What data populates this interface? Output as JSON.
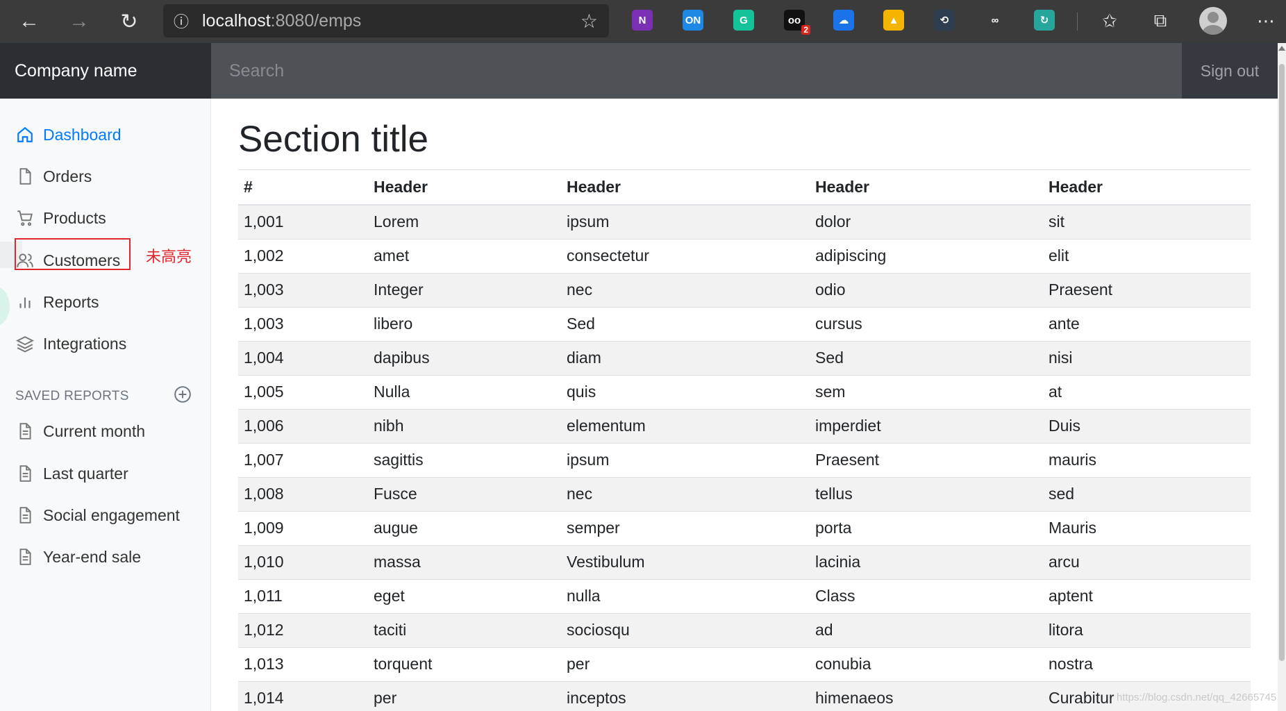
{
  "browser": {
    "url_host": "localhost",
    "url_path": ":8080/emps",
    "extensions": [
      {
        "name": "onenote-icon",
        "label": "N",
        "color": "#7b2fb5"
      },
      {
        "name": "onetab-icon",
        "label": "ON",
        "color": "#1e88e5"
      },
      {
        "name": "grammarly-icon",
        "label": "G",
        "color": "#15c39a"
      },
      {
        "name": "ext-badge-icon",
        "label": "oo",
        "color": "#111111",
        "badge": "2"
      },
      {
        "name": "cloud-icon",
        "label": "☁",
        "color": "#1a73e8"
      },
      {
        "name": "drive-icon",
        "label": "▲",
        "color": "#f4b400"
      },
      {
        "name": "link-icon",
        "label": "⟲",
        "color": "#2c3e50"
      },
      {
        "name": "chain-icon",
        "label": "∞",
        "color": "#3b3b3b"
      },
      {
        "name": "sync-icon",
        "label": "↻",
        "color": "#26a69a"
      }
    ]
  },
  "navbar": {
    "brand": "Company name",
    "search_placeholder": "Search",
    "signout": "Sign out"
  },
  "sidebar": {
    "items": [
      {
        "label": "Dashboard",
        "icon": "home-icon",
        "active": true
      },
      {
        "label": "Orders",
        "icon": "file-icon"
      },
      {
        "label": "Products",
        "icon": "cart-icon"
      },
      {
        "label": "Customers",
        "icon": "users-icon"
      },
      {
        "label": "Reports",
        "icon": "bar-chart-icon"
      },
      {
        "label": "Integrations",
        "icon": "layers-icon"
      }
    ],
    "annotation": "未高亮",
    "saved_heading": "SAVED REPORTS",
    "saved_items": [
      "Current month",
      "Last quarter",
      "Social engagement",
      "Year-end sale"
    ]
  },
  "main": {
    "title": "Section title",
    "headers": [
      "#",
      "Header",
      "Header",
      "Header",
      "Header"
    ],
    "rows": [
      [
        "1,001",
        "Lorem",
        "ipsum",
        "dolor",
        "sit"
      ],
      [
        "1,002",
        "amet",
        "consectetur",
        "adipiscing",
        "elit"
      ],
      [
        "1,003",
        "Integer",
        "nec",
        "odio",
        "Praesent"
      ],
      [
        "1,003",
        "libero",
        "Sed",
        "cursus",
        "ante"
      ],
      [
        "1,004",
        "dapibus",
        "diam",
        "Sed",
        "nisi"
      ],
      [
        "1,005",
        "Nulla",
        "quis",
        "sem",
        "at"
      ],
      [
        "1,006",
        "nibh",
        "elementum",
        "imperdiet",
        "Duis"
      ],
      [
        "1,007",
        "sagittis",
        "ipsum",
        "Praesent",
        "mauris"
      ],
      [
        "1,008",
        "Fusce",
        "nec",
        "tellus",
        "sed"
      ],
      [
        "1,009",
        "augue",
        "semper",
        "porta",
        "Mauris"
      ],
      [
        "1,010",
        "massa",
        "Vestibulum",
        "lacinia",
        "arcu"
      ],
      [
        "1,011",
        "eget",
        "nulla",
        "Class",
        "aptent"
      ],
      [
        "1,012",
        "taciti",
        "sociosqu",
        "ad",
        "litora"
      ],
      [
        "1,013",
        "torquent",
        "per",
        "conubia",
        "nostra"
      ],
      [
        "1,014",
        "per",
        "inceptos",
        "himenaeos",
        "Curabitur"
      ]
    ]
  },
  "watermark": "https://blog.csdn.net/qq_42665745",
  "colors": {
    "active": "#007bff",
    "navbar": "#343a40",
    "annotation": "#e0262d"
  }
}
